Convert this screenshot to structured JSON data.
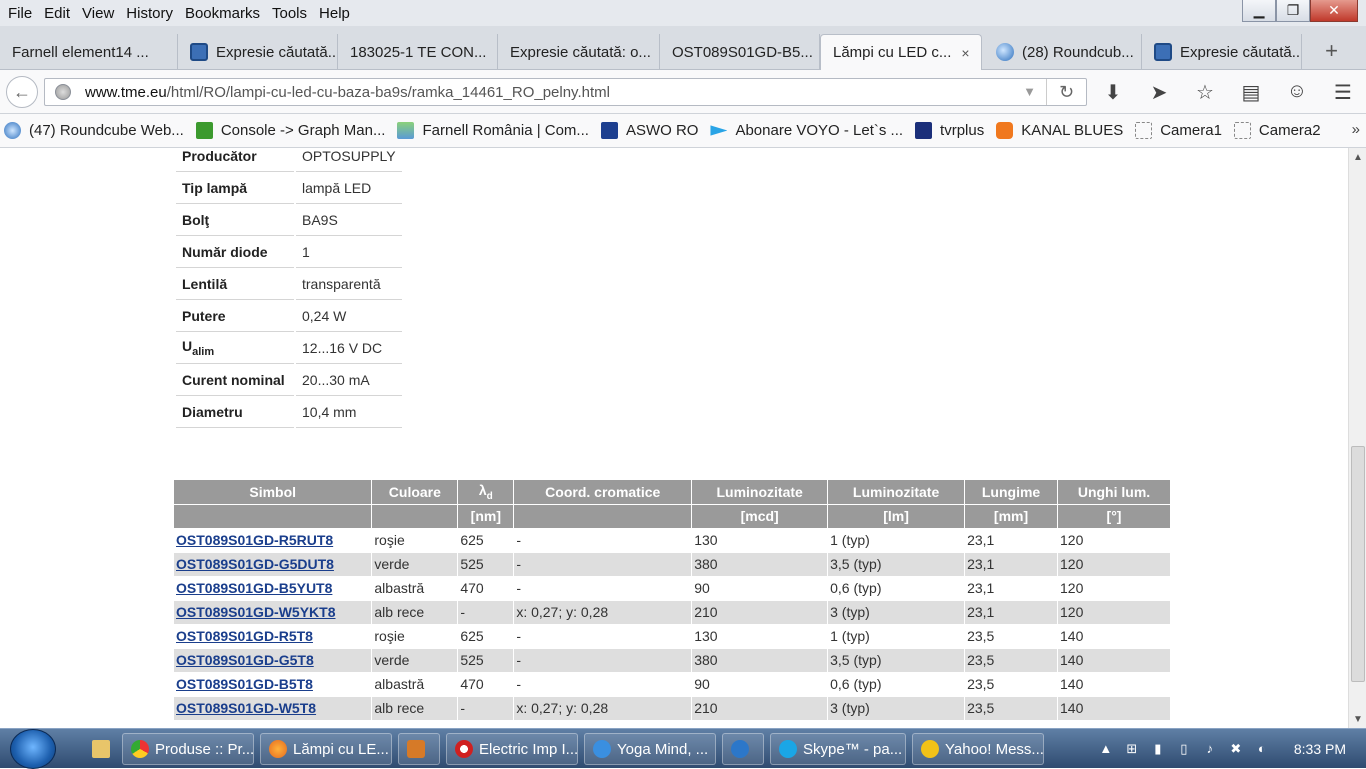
{
  "menubar": {
    "items": [
      "File",
      "Edit",
      "View",
      "History",
      "Bookmarks",
      "Tools",
      "Help"
    ]
  },
  "tabs": [
    {
      "label": "Farnell element14 ...",
      "icon": "none"
    },
    {
      "label": "Expresie căutată...",
      "icon": "tme-icon"
    },
    {
      "label": "183025-1 TE CON...",
      "icon": "none"
    },
    {
      "label": "Expresie căutată: o...",
      "icon": "none"
    },
    {
      "label": "OST089S01GD-B5...",
      "icon": "none"
    },
    {
      "label": "Lămpi cu LED c...",
      "icon": "none",
      "active": true
    },
    {
      "label": "(28) Roundcub...",
      "icon": "roundcube-icon"
    },
    {
      "label": "Expresie căutată...",
      "icon": "tme-icon"
    }
  ],
  "newtab": "+",
  "close_tab": "×",
  "url": {
    "domain": "www.tme.eu",
    "path": "/html/RO/lampi-cu-led-cu-baza-ba9s/ramka_14461_RO_pelny.html"
  },
  "bookmarks": [
    {
      "label": "(47) Roundcube Web...",
      "color": "#3a7bd5"
    },
    {
      "label": "Console -> Graph Man...",
      "color": "#3c9a2e"
    },
    {
      "label": "Farnell România | Com...",
      "color": "#5a9ad6"
    },
    {
      "label": "ASWO RO",
      "color": "#1d3f8f"
    },
    {
      "label": "Abonare VOYO - Let`s ...",
      "color": "#29a4e6"
    },
    {
      "label": "tvrplus",
      "color": "#1b2f7a"
    },
    {
      "label": "KANAL BLUES",
      "color": "#f0781e"
    },
    {
      "label": "Camera1",
      "color": "#ffffff"
    },
    {
      "label": "Camera2",
      "color": "#ffffff"
    }
  ],
  "bookmarks_more": "»",
  "specs": [
    {
      "key": "Producător",
      "value": "OPTOSUPPLY"
    },
    {
      "key": "Tip lampă",
      "value": "lampă LED"
    },
    {
      "key": "Bolţ",
      "value": "BA9S"
    },
    {
      "key": "Număr diode",
      "value": "1"
    },
    {
      "key": "Lentilă",
      "value": "transparentă"
    },
    {
      "key": "Putere",
      "value": "0,24 W"
    },
    {
      "key": "U",
      "key_sub": "alim",
      "value": "12...16 V DC"
    },
    {
      "key": "Curent nominal",
      "value": "20...30 mA"
    },
    {
      "key": "Diametru",
      "value": "10,4 mm"
    }
  ],
  "table": {
    "headers": [
      "Simbol",
      "Culoare",
      "λd",
      "Coord. cromatice",
      "Luminozitate",
      "Luminozitate",
      "Lungime",
      "Unghi lum."
    ],
    "units": [
      "",
      "",
      "[nm]",
      "",
      "[mcd]",
      "[lm]",
      "[mm]",
      "[°]"
    ],
    "rows": [
      [
        "OST089S01GD-R5RUT8",
        "roşie",
        "625",
        "-",
        "130",
        "1 (typ)",
        "23,1",
        "120"
      ],
      [
        "OST089S01GD-G5DUT8",
        "verde",
        "525",
        "-",
        "380",
        "3,5 (typ)",
        "23,1",
        "120"
      ],
      [
        "OST089S01GD-B5YUT8",
        "albastră",
        "470",
        "-",
        "90",
        "0,6 (typ)",
        "23,1",
        "120"
      ],
      [
        "OST089S01GD-W5YKT8",
        "alb rece",
        "-",
        "x: 0,27; y: 0,28",
        "210",
        "3 (typ)",
        "23,1",
        "120"
      ],
      [
        "OST089S01GD-R5T8",
        "roşie",
        "625",
        "-",
        "130",
        "1 (typ)",
        "23,5",
        "140"
      ],
      [
        "OST089S01GD-G5T8",
        "verde",
        "525",
        "-",
        "380",
        "3,5 (typ)",
        "23,5",
        "140"
      ],
      [
        "OST089S01GD-B5T8",
        "albastră",
        "470",
        "-",
        "90",
        "0,6 (typ)",
        "23,5",
        "140"
      ],
      [
        "OST089S01GD-W5T8",
        "alb rece",
        "-",
        "x: 0,27; y: 0,28",
        "210",
        "3 (typ)",
        "23,5",
        "140"
      ]
    ]
  },
  "taskbar": [
    {
      "label": "Produse :: Pr...",
      "color": "#e8c21a"
    },
    {
      "label": "Lămpi cu LE...",
      "color": "#e66a1f"
    },
    {
      "label": "",
      "color": "#d67a28"
    },
    {
      "label": "Electric Imp I...",
      "color": "#d02020"
    },
    {
      "label": "Yoga Mind, ...",
      "color": "#3a8fe0"
    },
    {
      "label": "",
      "color": "#2c77c9"
    },
    {
      "label": "Skype™ - pa...",
      "color": "#1aa6e6"
    },
    {
      "label": "Yahoo! Mess...",
      "color": "#f2c218"
    }
  ],
  "clock": "8:33 PM"
}
